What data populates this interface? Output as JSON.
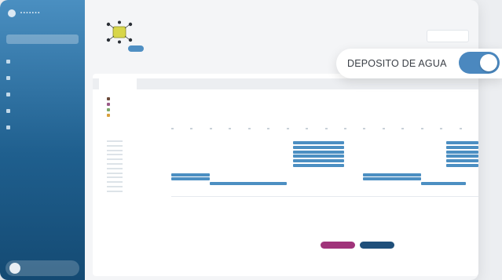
{
  "toggle": {
    "label": "DEPOSITO DE AGUA",
    "state": "on",
    "color": "#4b88bf"
  },
  "colors": {
    "sidebar_top": "#4a8fc1",
    "sidebar_bottom": "#144a73",
    "schedule_bar": "#4c8fc2",
    "button_primary": "#a0337a",
    "button_secondary": "#1f4f7a",
    "device_highlight": "#d8d64a"
  },
  "icons": {
    "brand": "logo-icon",
    "nav": [
      "home-icon",
      "user-icon",
      "calendar-icon",
      "settings-icon",
      "map-icon"
    ],
    "device": "device-icon"
  },
  "schedule": {
    "rows": 12,
    "bars": [
      {
        "row": 0,
        "start": 9.5,
        "end": 13.5
      },
      {
        "row": 1,
        "start": 9.5,
        "end": 13.5
      },
      {
        "row": 2,
        "start": 9.5,
        "end": 13.5
      },
      {
        "row": 3,
        "start": 9.5,
        "end": 13.5
      },
      {
        "row": 4,
        "start": 9.5,
        "end": 13.5
      },
      {
        "row": 5,
        "start": 9.5,
        "end": 13.5
      },
      {
        "row": 0,
        "start": 21.5,
        "end": 24
      },
      {
        "row": 1,
        "start": 21.5,
        "end": 24
      },
      {
        "row": 2,
        "start": 21.5,
        "end": 24
      },
      {
        "row": 3,
        "start": 21.5,
        "end": 24
      },
      {
        "row": 4,
        "start": 21.5,
        "end": 24
      },
      {
        "row": 5,
        "start": 21.5,
        "end": 24
      },
      {
        "row": 7,
        "start": 0,
        "end": 3
      },
      {
        "row": 8,
        "start": 0,
        "end": 3
      },
      {
        "row": 7,
        "start": 15,
        "end": 19.5
      },
      {
        "row": 8,
        "start": 15,
        "end": 19.5
      },
      {
        "row": 9,
        "start": 3,
        "end": 9
      },
      {
        "row": 9,
        "start": 19.5,
        "end": 23
      }
    ]
  }
}
